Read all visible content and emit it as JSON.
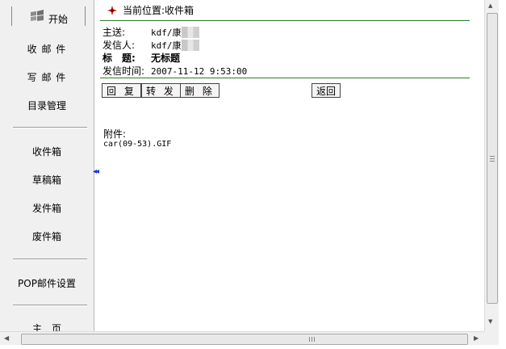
{
  "sidebar": {
    "start_label": "开始",
    "items": [
      {
        "label": "收 邮 件"
      },
      {
        "label": "写 邮 件"
      },
      {
        "label": "目录管理"
      },
      {
        "label": "收件箱"
      },
      {
        "label": "草稿箱"
      },
      {
        "label": "发件箱"
      },
      {
        "label": "废件箱"
      },
      {
        "label": "POP邮件设置"
      },
      {
        "label": "主　页"
      }
    ],
    "collapse_glyph": "◂◂"
  },
  "message": {
    "location": "当前位置:收件箱",
    "to_label": "主送:",
    "to_value": "kdf/康",
    "from_label": "发信人:",
    "from_value": "kdf/康",
    "subject_label": "标　题:",
    "subject_value": "无标题",
    "time_label": "发信时间:",
    "time_value": "2007-11-12 9:53:00",
    "buttons": {
      "reply": "回 复",
      "forward": "转 发",
      "delete": "删 除",
      "back": "返回"
    },
    "attachment_label": "附件:",
    "attachment_file": "car(09-53).GIF"
  },
  "colors": {
    "rule": "#2b7a2b",
    "collapse_arrow": "#1a3ccc"
  }
}
